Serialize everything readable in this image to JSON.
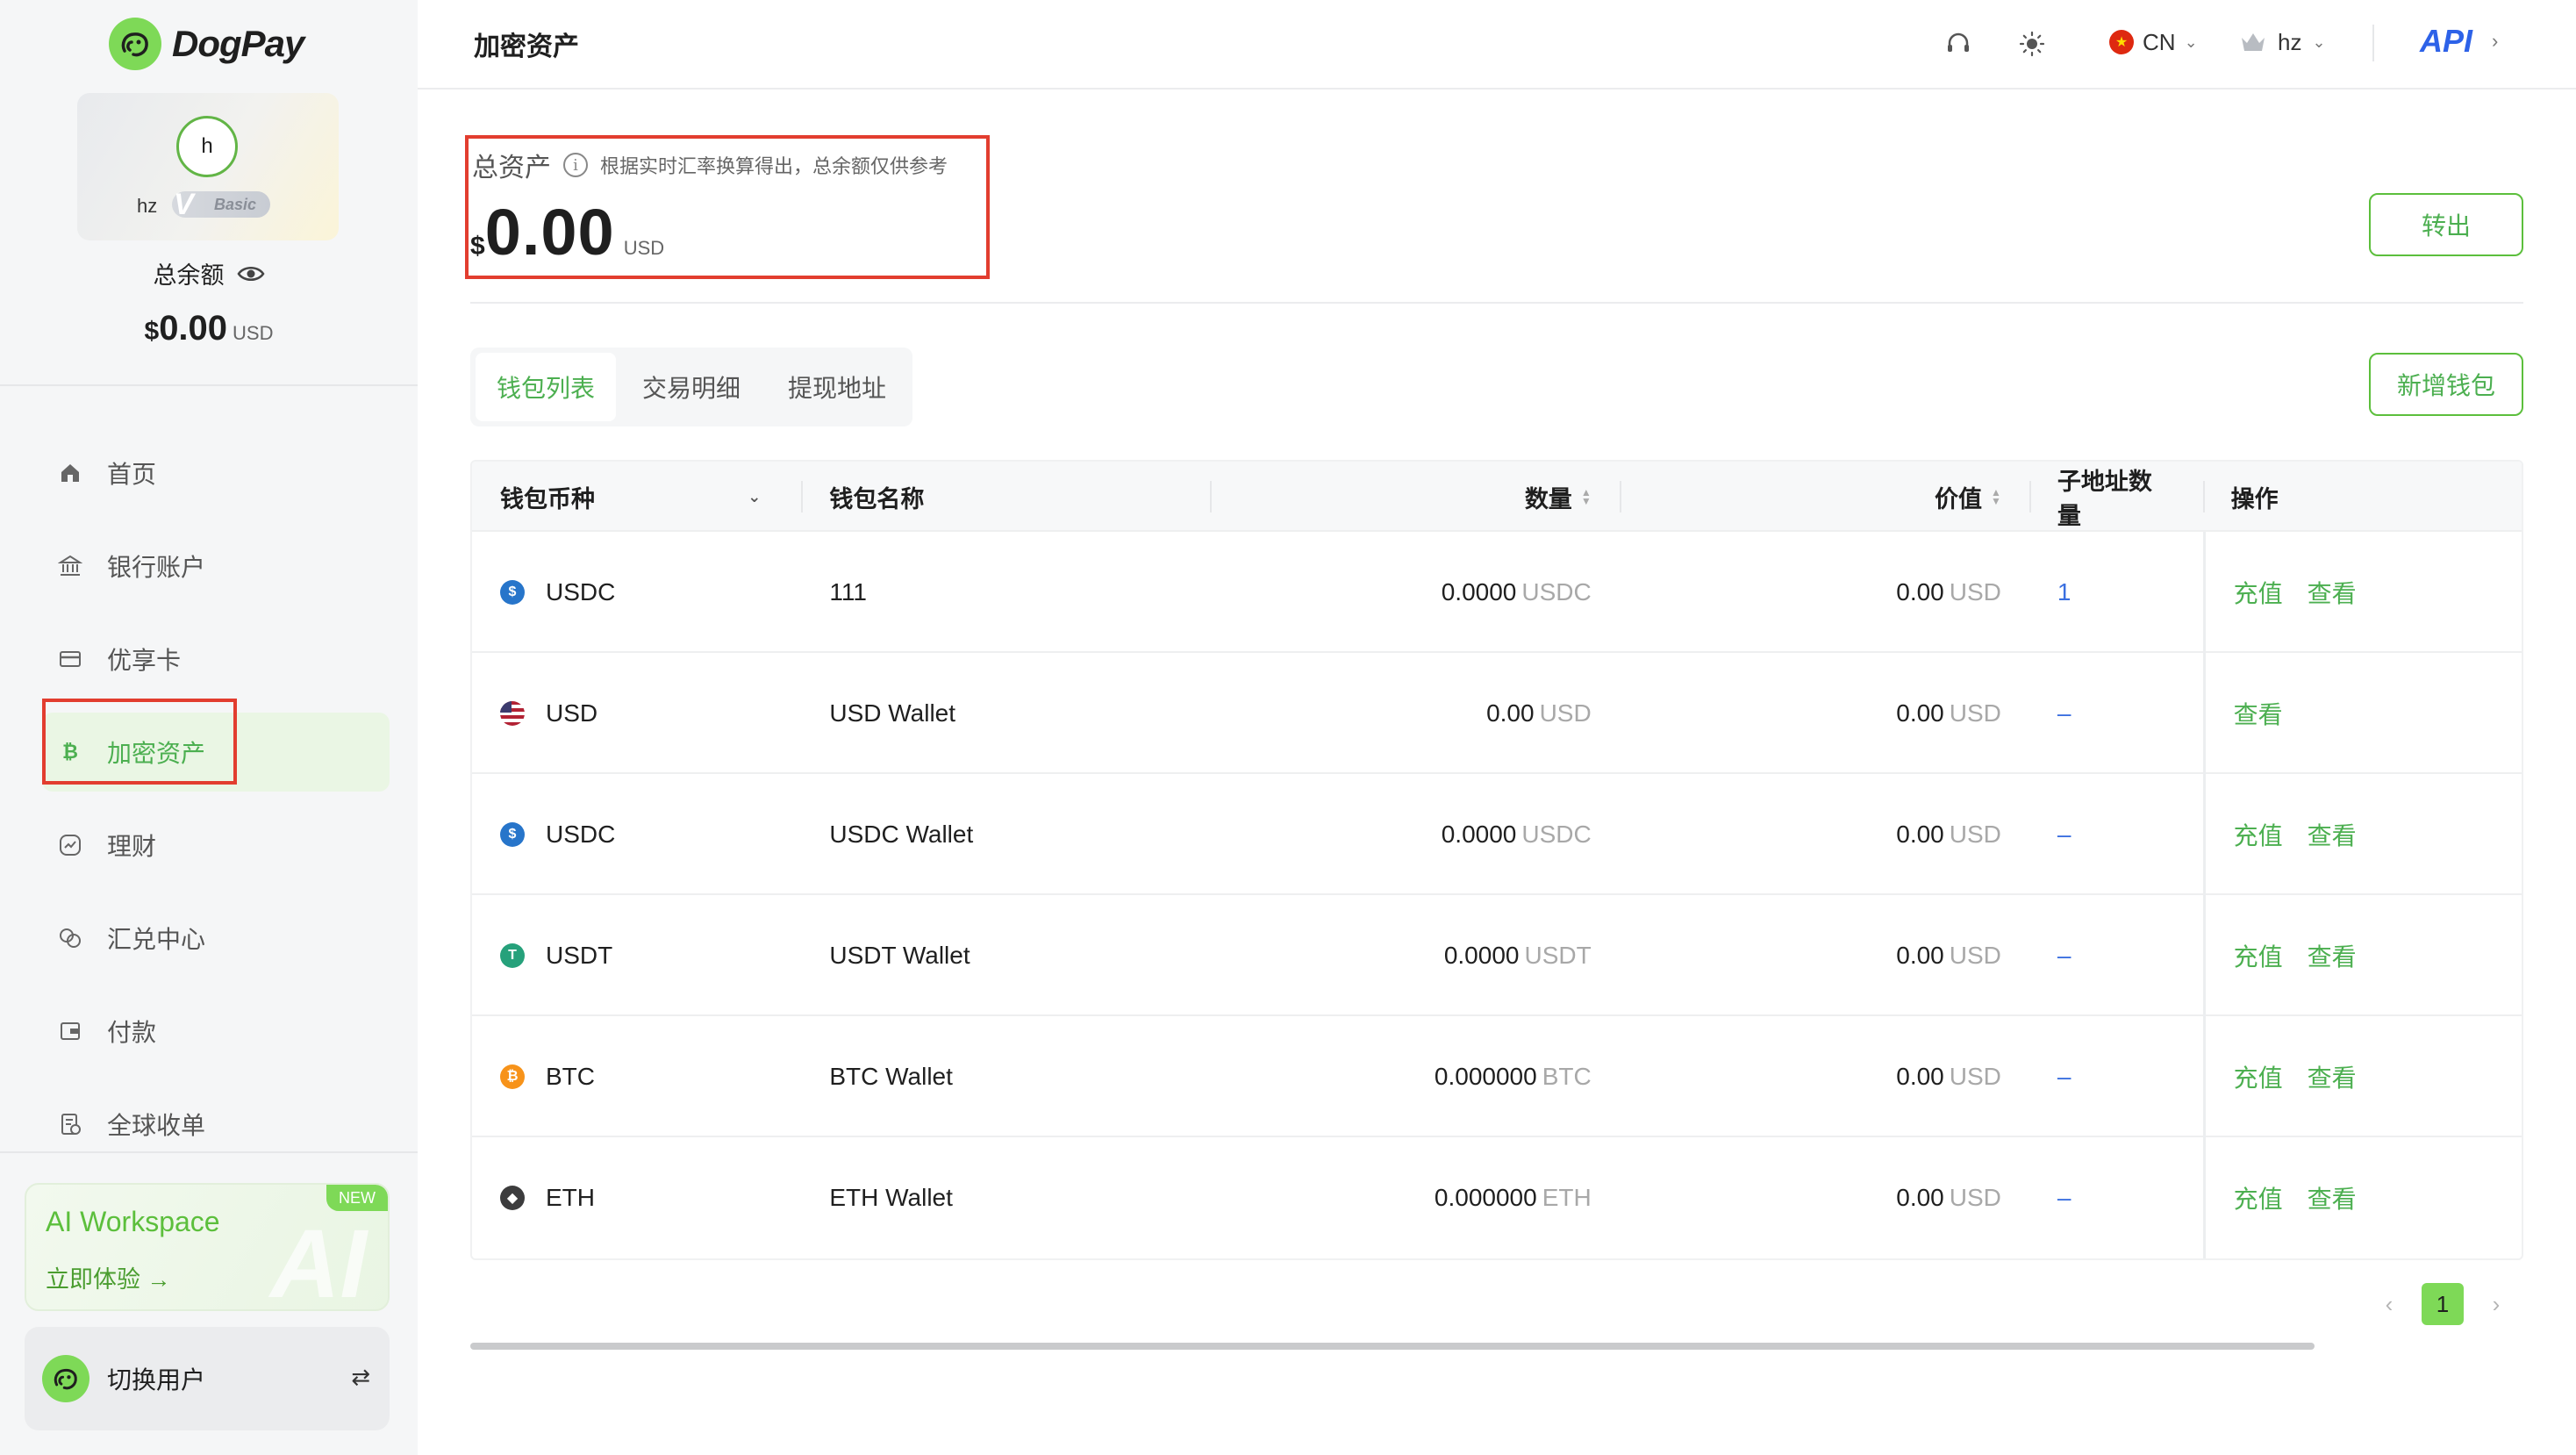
{
  "brand": {
    "name": "DogPay"
  },
  "profile": {
    "avatar_letter": "h",
    "name": "hz",
    "tier": "Basic",
    "tier_mark": "V"
  },
  "sidebar_balance": {
    "label": "总余额",
    "currency_symbol": "$",
    "amount": "0.00",
    "unit": "USD"
  },
  "nav": {
    "items": [
      {
        "label": "首页",
        "icon": "home-icon"
      },
      {
        "label": "银行账户",
        "icon": "bank-icon"
      },
      {
        "label": "优享卡",
        "icon": "card-icon"
      },
      {
        "label": "加密资产",
        "icon": "bitcoin-icon",
        "active": true
      },
      {
        "label": "理财",
        "icon": "finance-icon"
      },
      {
        "label": "汇兑中心",
        "icon": "exchange-icon"
      },
      {
        "label": "付款",
        "icon": "wallet-icon"
      },
      {
        "label": "全球收单",
        "icon": "receipt-icon"
      }
    ]
  },
  "ai_promo": {
    "title": "AI Workspace",
    "cta": "立即体验",
    "arrow": "→",
    "badge": "NEW",
    "deco": "AI"
  },
  "switch_user": {
    "label": "切换用户",
    "arrows": "⇄"
  },
  "header": {
    "title": "加密资产",
    "lang": "CN",
    "user": "hz",
    "api": "API"
  },
  "total_assets": {
    "label": "总资产",
    "hint": "根据实时汇率换算得出，总余额仅供参考",
    "currency_symbol": "$",
    "amount": "0.00",
    "unit": "USD"
  },
  "actions": {
    "transfer_out": "转出",
    "add_wallet": "新增钱包"
  },
  "tabs": [
    {
      "label": "钱包列表",
      "active": true
    },
    {
      "label": "交易明细",
      "active": false
    },
    {
      "label": "提现地址",
      "active": false
    }
  ],
  "table": {
    "headers": {
      "currency": "钱包币种",
      "name": "钱包名称",
      "quantity": "数量",
      "value": "价值",
      "sub_addresses": "子地址数量",
      "actions": "操作"
    },
    "rows": [
      {
        "coin": "USDC",
        "icon": "usdc-icon",
        "color": "#2775ca",
        "name": "111",
        "qty": "0.0000",
        "qty_unit": "USDC",
        "value": "0.00",
        "value_unit": "USD",
        "sub": "1",
        "deposit": "充值",
        "view": "查看"
      },
      {
        "coin": "USD",
        "icon": "us-flag-icon",
        "color": "#b22234",
        "name": "USD Wallet",
        "qty": "0.00",
        "qty_unit": "USD",
        "value": "0.00",
        "value_unit": "USD",
        "sub": "–",
        "deposit": "",
        "view": "查看"
      },
      {
        "coin": "USDC",
        "icon": "usdc-icon",
        "color": "#2775ca",
        "name": "USDC Wallet",
        "qty": "0.0000",
        "qty_unit": "USDC",
        "value": "0.00",
        "value_unit": "USD",
        "sub": "–",
        "deposit": "充值",
        "view": "查看"
      },
      {
        "coin": "USDT",
        "icon": "usdt-icon",
        "color": "#26a17b",
        "name": "USDT Wallet",
        "qty": "0.0000",
        "qty_unit": "USDT",
        "value": "0.00",
        "value_unit": "USD",
        "sub": "–",
        "deposit": "充值",
        "view": "查看"
      },
      {
        "coin": "BTC",
        "icon": "btc-icon",
        "color": "#f7931a",
        "name": "BTC Wallet",
        "qty": "0.000000",
        "qty_unit": "BTC",
        "value": "0.00",
        "value_unit": "USD",
        "sub": "–",
        "deposit": "充值",
        "view": "查看"
      },
      {
        "coin": "ETH",
        "icon": "eth-icon",
        "color": "#3c3c3d",
        "name": "ETH Wallet",
        "qty": "0.000000",
        "qty_unit": "ETH",
        "value": "0.00",
        "value_unit": "USD",
        "sub": "–",
        "deposit": "充值",
        "view": "查看"
      }
    ]
  },
  "pagination": {
    "current": "1",
    "prev": "‹",
    "next": "›"
  },
  "colors": {
    "accent": "#4caf50",
    "brand_green": "#7ed957",
    "highlight_red": "#e23d2f",
    "link_blue": "#3a6fe0"
  }
}
